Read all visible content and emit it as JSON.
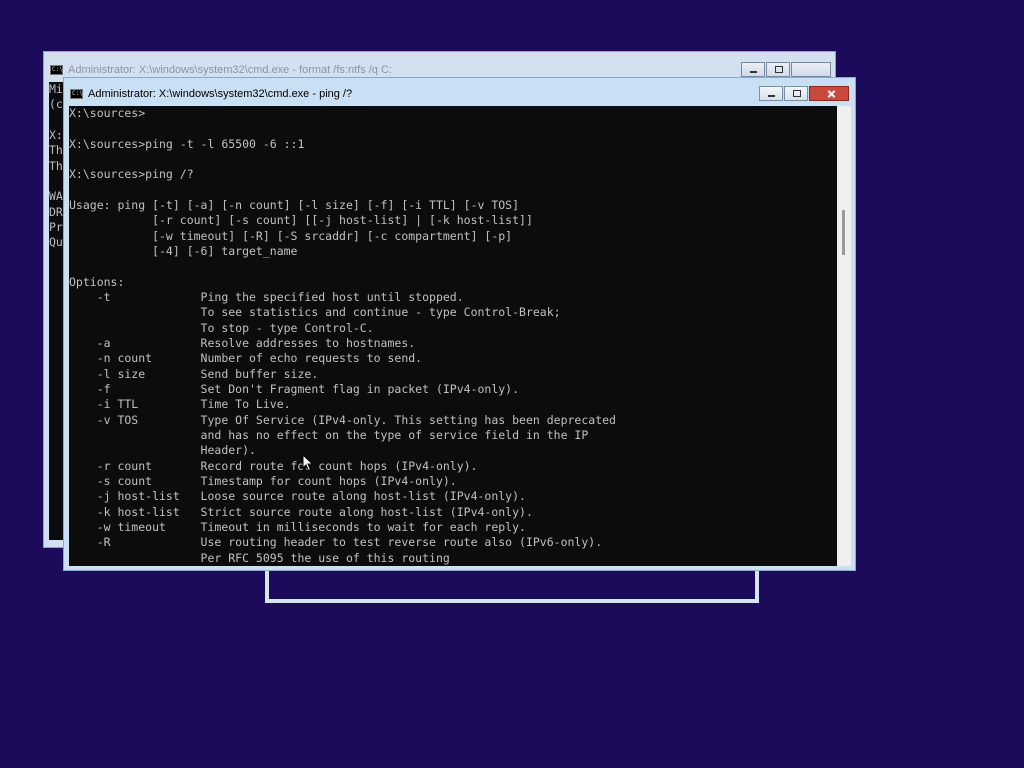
{
  "background_window": {
    "title": "Administrator: X:\\windows\\system32\\cmd.exe - format  /fs:ntfs /q C:",
    "visible_lines": [
      "Mi",
      "(c",
      "",
      "X:",
      "Th",
      "Th",
      "",
      "WA",
      "DR",
      "Pr",
      "Qu"
    ]
  },
  "front_window": {
    "title": "Administrator: X:\\windows\\system32\\cmd.exe - ping  /?",
    "lines": [
      "X:\\sources>",
      "",
      "X:\\sources>ping -t -l 65500 -6 ::1",
      "",
      "X:\\sources>ping /?",
      "",
      "Usage: ping [-t] [-a] [-n count] [-l size] [-f] [-i TTL] [-v TOS]",
      "            [-r count] [-s count] [[-j host-list] | [-k host-list]]",
      "            [-w timeout] [-R] [-S srcaddr] [-c compartment] [-p]",
      "            [-4] [-6] target_name",
      "",
      "Options:",
      "    -t             Ping the specified host until stopped.",
      "                   To see statistics and continue - type Control-Break;",
      "                   To stop - type Control-C.",
      "    -a             Resolve addresses to hostnames.",
      "    -n count       Number of echo requests to send.",
      "    -l size        Send buffer size.",
      "    -f             Set Don't Fragment flag in packet (IPv4-only).",
      "    -i TTL         Time To Live.",
      "    -v TOS         Type Of Service (IPv4-only. This setting has been deprecated",
      "                   and has no effect on the type of service field in the IP",
      "                   Header).",
      "    -r count       Record route for count hops (IPv4-only).",
      "    -s count       Timestamp for count hops (IPv4-only).",
      "    -j host-list   Loose source route along host-list (IPv4-only).",
      "    -k host-list   Strict source route along host-list (IPv4-only).",
      "    -w timeout     Timeout in milliseconds to wait for each reply.",
      "    -R             Use routing header to test reverse route also (IPv6-only).",
      "                   Per RFC 5095 the use of this routing"
    ]
  },
  "icons": {
    "window_icon": "cmd-icon",
    "minimize": "minimize-icon",
    "restore": "restore-icon",
    "close": "close-icon",
    "pointer": "mouse-pointer-icon"
  },
  "colors": {
    "desktop": "#1c0a5a",
    "console_bg": "#0c0c0c",
    "console_fg": "#c0c0c0",
    "window_frame": "#c9dff4",
    "close_button": "#c94a3d"
  }
}
